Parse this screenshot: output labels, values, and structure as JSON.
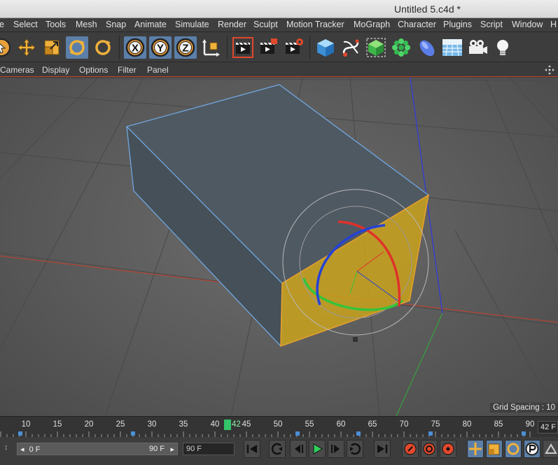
{
  "window": {
    "title": "Untitled 5.c4d *"
  },
  "menu": [
    "e",
    "Select",
    "Tools",
    "Mesh",
    "Snap",
    "Animate",
    "Simulate",
    "Render",
    "Sculpt",
    "Motion Tracker",
    "MoGraph",
    "Character",
    "Plugins",
    "Script",
    "Window",
    "H"
  ],
  "toolbar": {
    "icons": [
      "live-selection-icon",
      "move-icon",
      "scale-icon",
      "rotate-icon",
      "recent-tool-icon",
      "x-axis-lock-icon",
      "y-axis-lock-icon",
      "z-axis-lock-icon",
      "coordinate-system-icon",
      "render-view-icon",
      "render-picture-viewer-icon",
      "render-settings-icon",
      "cube-primitive-icon",
      "spline-pen-icon",
      "subdivision-surface-icon",
      "cloner-icon",
      "deformer-icon",
      "floor-icon",
      "camera-icon",
      "light-icon"
    ],
    "x_label": "X",
    "y_label": "Y",
    "z_label": "Z"
  },
  "view_menu": [
    "Cameras",
    "Display",
    "Options",
    "Filter",
    "Panel"
  ],
  "viewport": {
    "grid_spacing": "Grid Spacing : 10"
  },
  "timeline": {
    "ticks": [
      "10",
      "15",
      "20",
      "25",
      "30",
      "35",
      "40",
      "45",
      "50",
      "55",
      "60",
      "65",
      "70",
      "75",
      "80",
      "85",
      "90"
    ],
    "current_frame": "42",
    "current_frame_field": "42 F"
  },
  "transport": {
    "range_start": "0 F",
    "range_end": "90 F",
    "end_frame": "90 F",
    "left_arrow": "◂",
    "right_arrow": "▸"
  },
  "colors": {
    "selected_face": "#c9a21c",
    "x_axis": "#e0312a",
    "y_axis": "#34c43a",
    "z_axis": "#2442d8",
    "highlight": "#5b7fa8"
  }
}
